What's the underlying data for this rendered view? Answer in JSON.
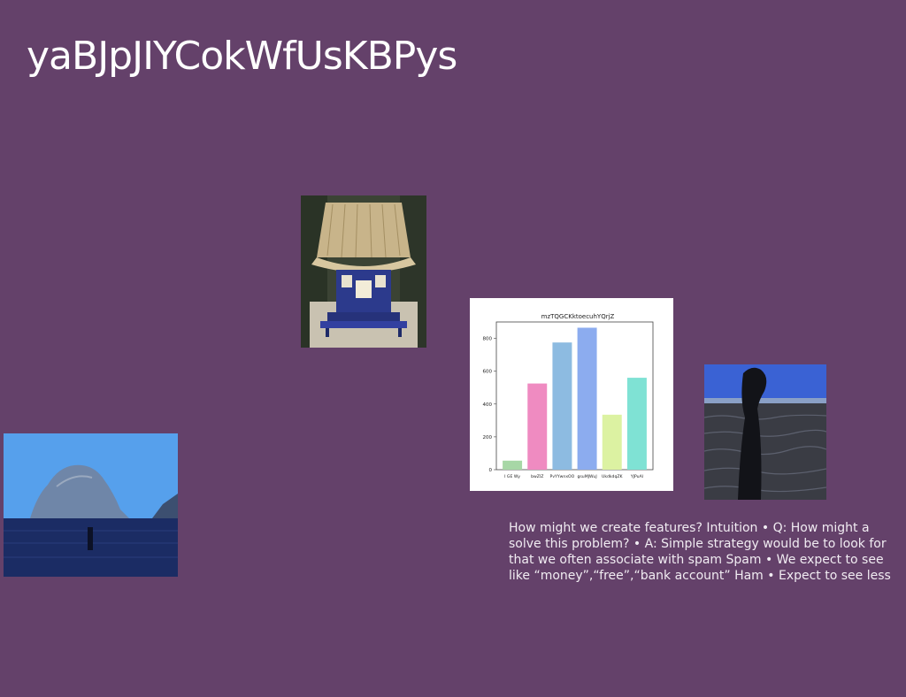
{
  "slide": {
    "title": "yaBJpJIYCokWfUsKBPys",
    "notes": "How might we create features? Intuition • Q: How might a solve this problem? • A: Simple strategy would be to look for that we often associate with spam Spam • We expect to see like “money”,“free”,“bank account” Ham • Expect to see less"
  },
  "chart_data": {
    "type": "bar",
    "title": "mzTQGCKktoecuhYQrjZ",
    "categories": [
      "I GE Wy",
      "bwZlZ",
      "PvYYwnxOO",
      "gsuMJWuJ",
      "UkdkdqZK",
      "YJPuAl"
    ],
    "values": [
      55,
      525,
      775,
      865,
      335,
      560
    ],
    "colors": [
      "#a7d7a6",
      "#ef8bc1",
      "#8dbbe1",
      "#8cacef",
      "#dcf2a2",
      "#7fe2d4"
    ],
    "ylim": [
      0,
      900
    ],
    "yticks": [
      0,
      200,
      400,
      600,
      800
    ],
    "xlabel": "",
    "ylabel": ""
  }
}
